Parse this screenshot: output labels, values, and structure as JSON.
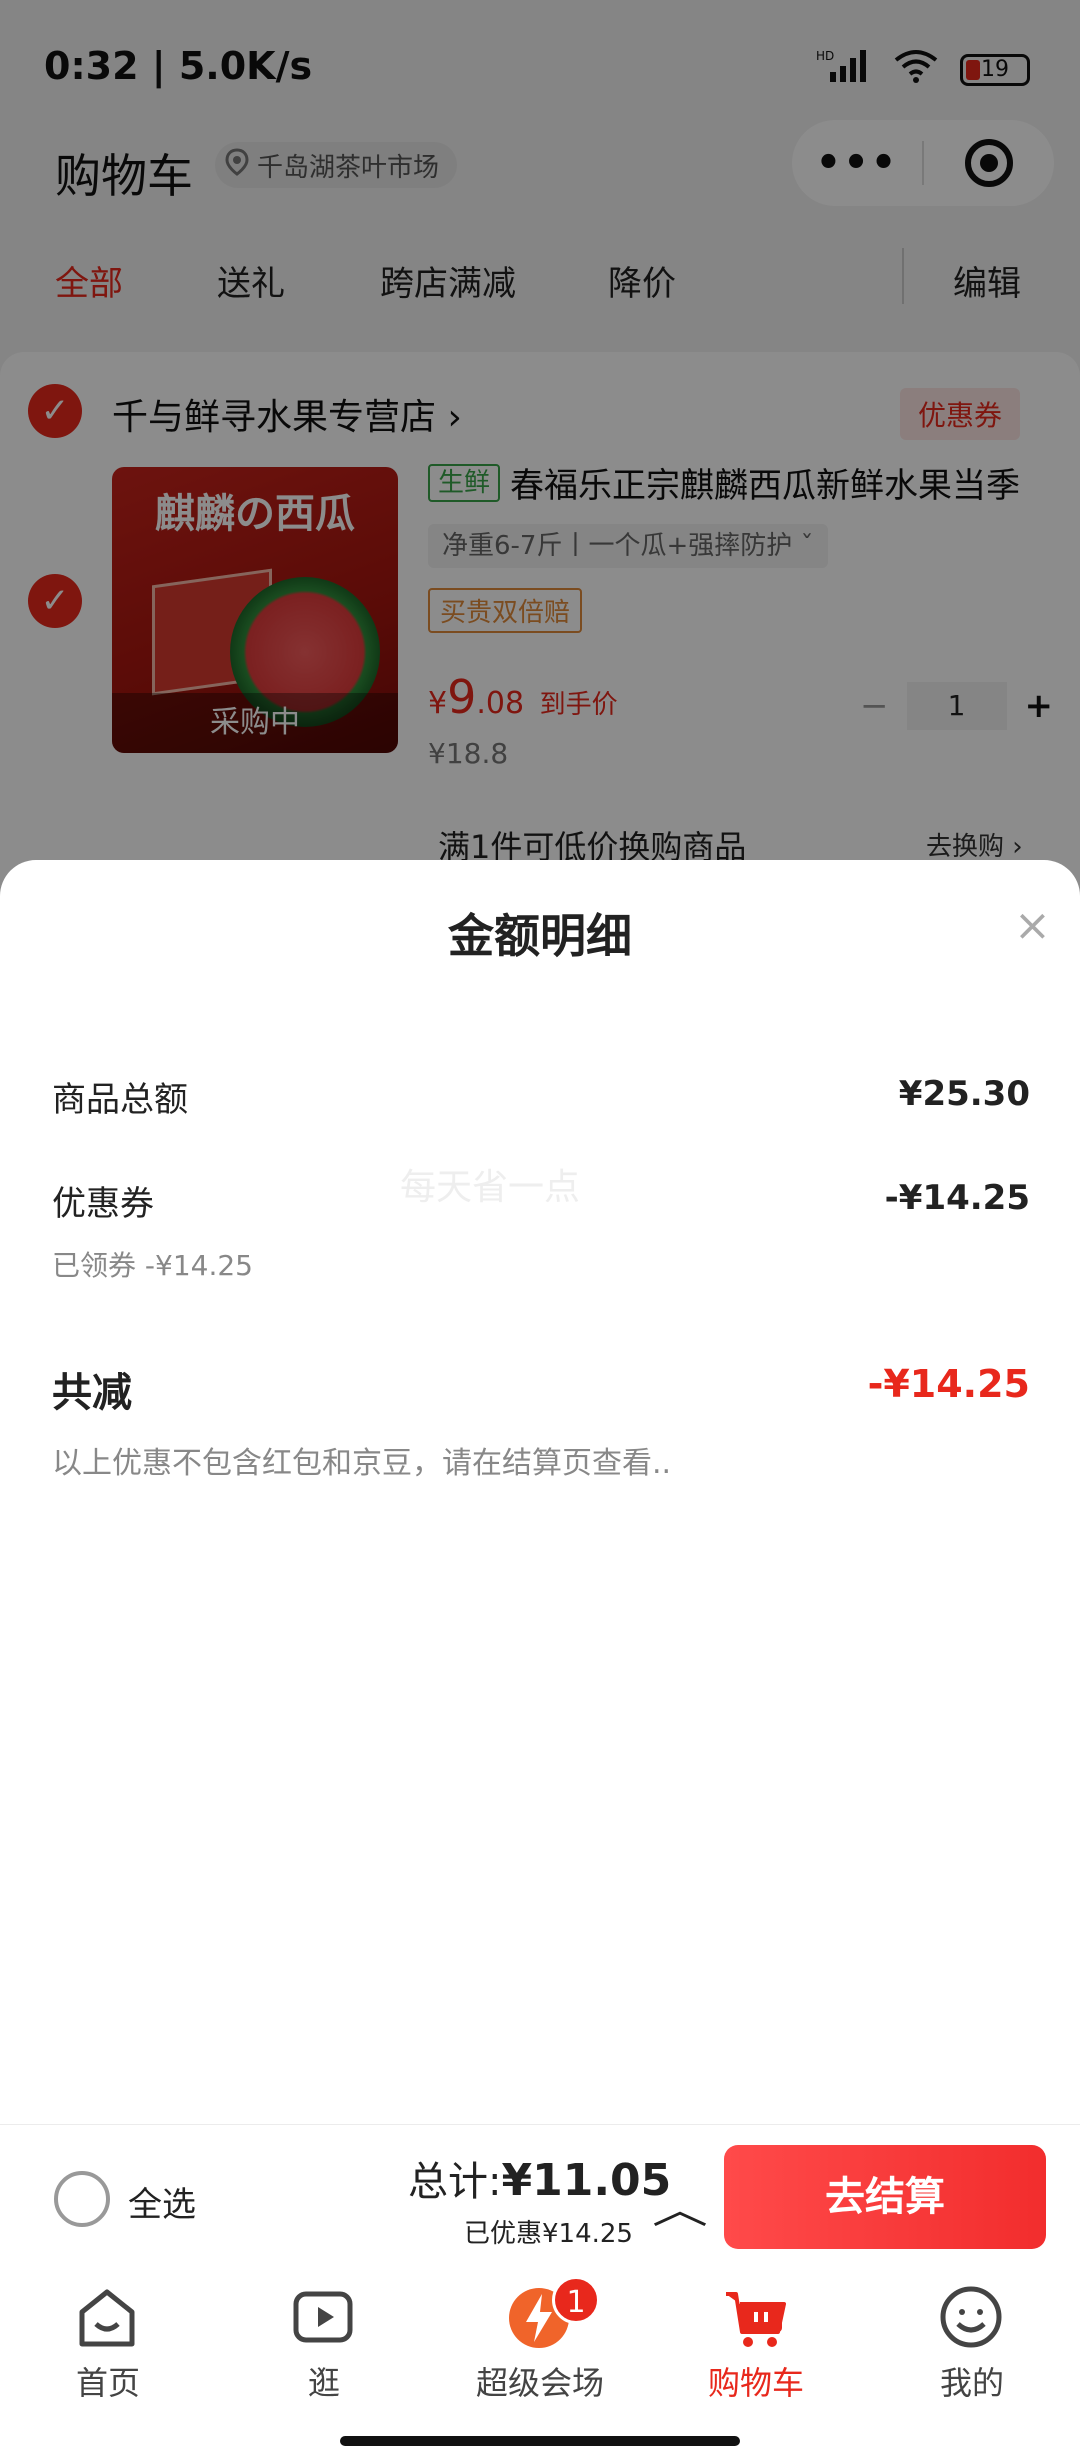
{
  "status_bar": {
    "time": "0:32 | 5.0K/s",
    "network": "HD",
    "wifi": "6",
    "battery": "19"
  },
  "header": {
    "title": "购物车",
    "location": "千岛湖茶叶市场",
    "capsule_more": "•••"
  },
  "tabs": [
    {
      "label": "全部",
      "active": true
    },
    {
      "label": "送礼"
    },
    {
      "label": "跨店满减"
    },
    {
      "label": "降价"
    },
    {
      "label": "编辑"
    }
  ],
  "store": {
    "name": "千与鲜寻水果专营店 ›",
    "coupon_tag": "优惠券",
    "product": {
      "image_title": "麒麟の西瓜",
      "image_overlay": "采购中",
      "fresh_tag": "生鲜",
      "title": "春福乐正宗麒麟西瓜新鲜水果当季",
      "spec": "净重6-7斤丨一个瓜+强摔防护 ˇ",
      "insure_tag": "买贵双倍赔",
      "price_symbol": "¥",
      "price_big": "9",
      "price_small": ".08",
      "price_note": "到手价",
      "price_old": "¥18.8",
      "quantity": "1",
      "minus": "−",
      "plus": "+"
    },
    "promo": {
      "text": "满1件可低价换购商品",
      "link": "去换购 ›"
    }
  },
  "sheet": {
    "title": "金额明细",
    "close": "×",
    "watermark": "每天省一点",
    "goods_total_label": "商品总额",
    "goods_total_value": "¥25.30",
    "coupon_label": "优惠券",
    "coupon_value": "-¥14.25",
    "coupon_sub": "已领券 -¥14.25",
    "total_label": "共减",
    "total_value": "-¥14.25",
    "note": "以上优惠不包含红包和京豆，请在结算页查看.."
  },
  "checkout": {
    "select_all": "全选",
    "sum_label": "总计:",
    "sum_value": "¥11.05",
    "saved": "已优惠¥14.25",
    "expand_icon": "︿",
    "button": "去结算"
  },
  "tabbar": [
    {
      "label": "首页",
      "icon": "home-icon"
    },
    {
      "label": "逛",
      "icon": "video-icon"
    },
    {
      "label": "超级会场",
      "icon": "super-venue-icon",
      "badge": "1"
    },
    {
      "label": "购物车",
      "icon": "cart-icon",
      "active": true
    },
    {
      "label": "我的",
      "icon": "profile-icon"
    }
  ],
  "colors": {
    "accent": "#e8281c",
    "checkout_button": "#f22d2d",
    "fresh_green": "#3aa54a"
  }
}
